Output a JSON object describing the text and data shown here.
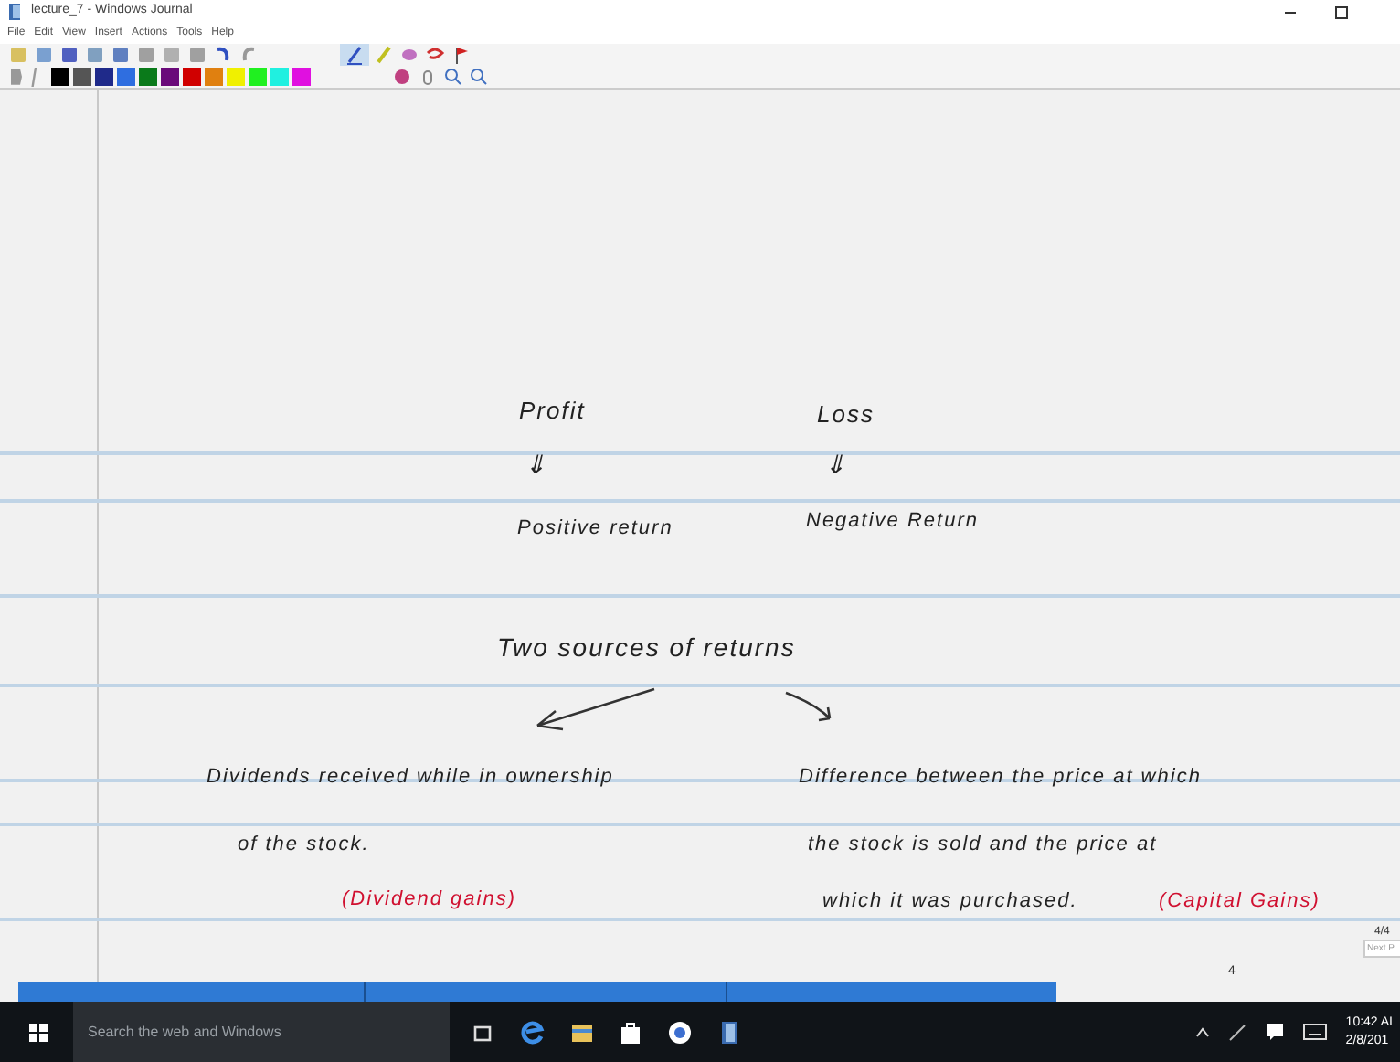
{
  "window": {
    "title": "lecture_7 - Windows Journal"
  },
  "menu": [
    "File",
    "Edit",
    "View",
    "Insert",
    "Actions",
    "Tools",
    "Help"
  ],
  "palette": [
    {
      "color": "#000000"
    },
    {
      "color": "#555555"
    },
    {
      "color": "#1f2a8a"
    },
    {
      "color": "#2f6ee0"
    },
    {
      "color": "#0a7a1a"
    },
    {
      "color": "#6a0a7a"
    },
    {
      "color": "#d00000"
    },
    {
      "color": "#e08010"
    },
    {
      "color": "#f0f000"
    },
    {
      "color": "#20f020"
    },
    {
      "color": "#20f0e0"
    },
    {
      "color": "#e010e0"
    }
  ],
  "notes": [
    {
      "text": "Profit",
      "color": "#222222"
    },
    {
      "text": "Loss",
      "color": "#222222"
    },
    {
      "text": "⇓",
      "color": "#222222"
    },
    {
      "text": "⇓",
      "color": "#222222"
    },
    {
      "text": "Positive return",
      "color": "#222222"
    },
    {
      "text": "Negative Return",
      "color": "#222222"
    },
    {
      "text": "Two sources of returns",
      "color": "#222222"
    },
    {
      "text": "Dividends received while in ownership",
      "color": "#222222"
    },
    {
      "text": "of the stock.",
      "color": "#222222"
    },
    {
      "text": "(Dividend gains)",
      "color": "#d01030"
    },
    {
      "text": "Difference between the price at which",
      "color": "#222222"
    },
    {
      "text": "the stock is sold and the price at",
      "color": "#222222"
    },
    {
      "text": "which it was purchased.",
      "color": "#222222"
    },
    {
      "text": "(Capital Gains)",
      "color": "#d01030"
    }
  ],
  "page_counter": "4/4",
  "next_page": "Next P",
  "page_number": "4",
  "taskbar": {
    "search_placeholder": "Search the web and Windows",
    "time": "10:42 AI",
    "date": "2/8/201"
  }
}
